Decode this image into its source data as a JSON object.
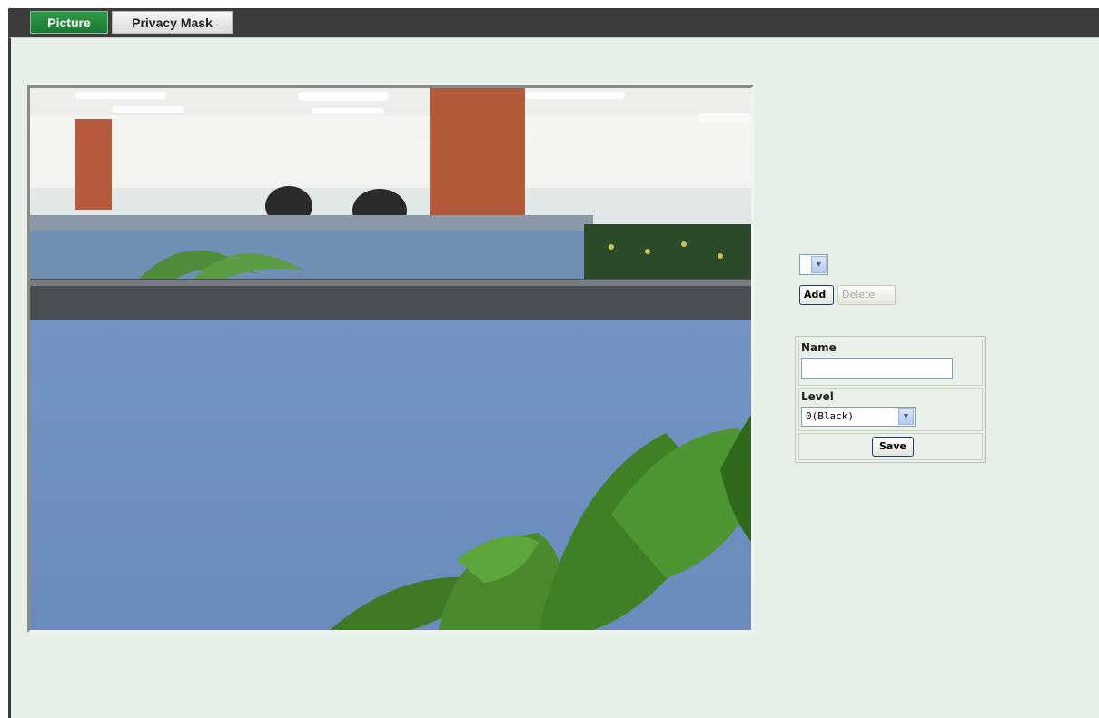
{
  "tabs": [
    {
      "label": "Picture",
      "active": true
    },
    {
      "label": "Privacy Mask",
      "active": false
    }
  ],
  "video": {
    "feed_icon": "camera-feed"
  },
  "mask": {
    "selected": "",
    "add_label": "Add",
    "delete_label": "Delete",
    "delete_disabled": true
  },
  "props": {
    "name_label": "Name",
    "name_value": "",
    "level_label": "Level",
    "level_value": "0(Black)",
    "save_label": "Save"
  },
  "colors": {
    "topbar": "#3c3c3c",
    "active_tab": "#1c7a33",
    "content_bg": "#e6f0e6"
  }
}
